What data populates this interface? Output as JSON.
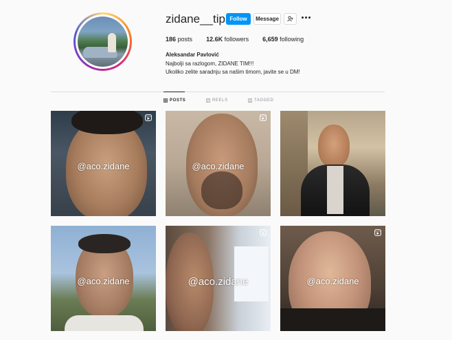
{
  "profile": {
    "username": "zidane__tips",
    "full_name": "Aleksandar Pavlović",
    "bio_lines": [
      "Najbolji sa razlogom, ZIDANE TIM!!!",
      "Ukoliko zelite saradnju sa našim timom, javite se u DM!"
    ],
    "stats": {
      "posts_count": "186",
      "posts_label": "posts",
      "followers_count": "12.6K",
      "followers_label": "followers",
      "following_count": "6,659",
      "following_label": "following"
    }
  },
  "actions": {
    "follow_label": "Follow",
    "message_label": "Message",
    "suggest_icon": "add-user-icon",
    "more_icon": "more-icon"
  },
  "tabs": [
    {
      "label": "POSTS",
      "icon": "grid-icon",
      "active": true
    },
    {
      "label": "REELS",
      "icon": "reels-icon",
      "active": false
    },
    {
      "label": "TAGGED",
      "icon": "tagged-icon",
      "active": false
    }
  ],
  "posts": [
    {
      "watermark": "@aco.zidane",
      "is_reel": true
    },
    {
      "watermark": "@aco.zidane",
      "is_reel": true
    },
    {
      "watermark": "",
      "is_reel": false
    },
    {
      "watermark": "@aco.zidane",
      "is_reel": false
    },
    {
      "watermark": "@aco.zidane",
      "is_reel": true
    },
    {
      "watermark": "@aco.zidane",
      "is_reel": true
    }
  ],
  "colors": {
    "accent": "#0095f6",
    "text": "#262626",
    "muted": "#8e8e8e",
    "border": "#dbdbdb",
    "background": "#fafafa"
  }
}
